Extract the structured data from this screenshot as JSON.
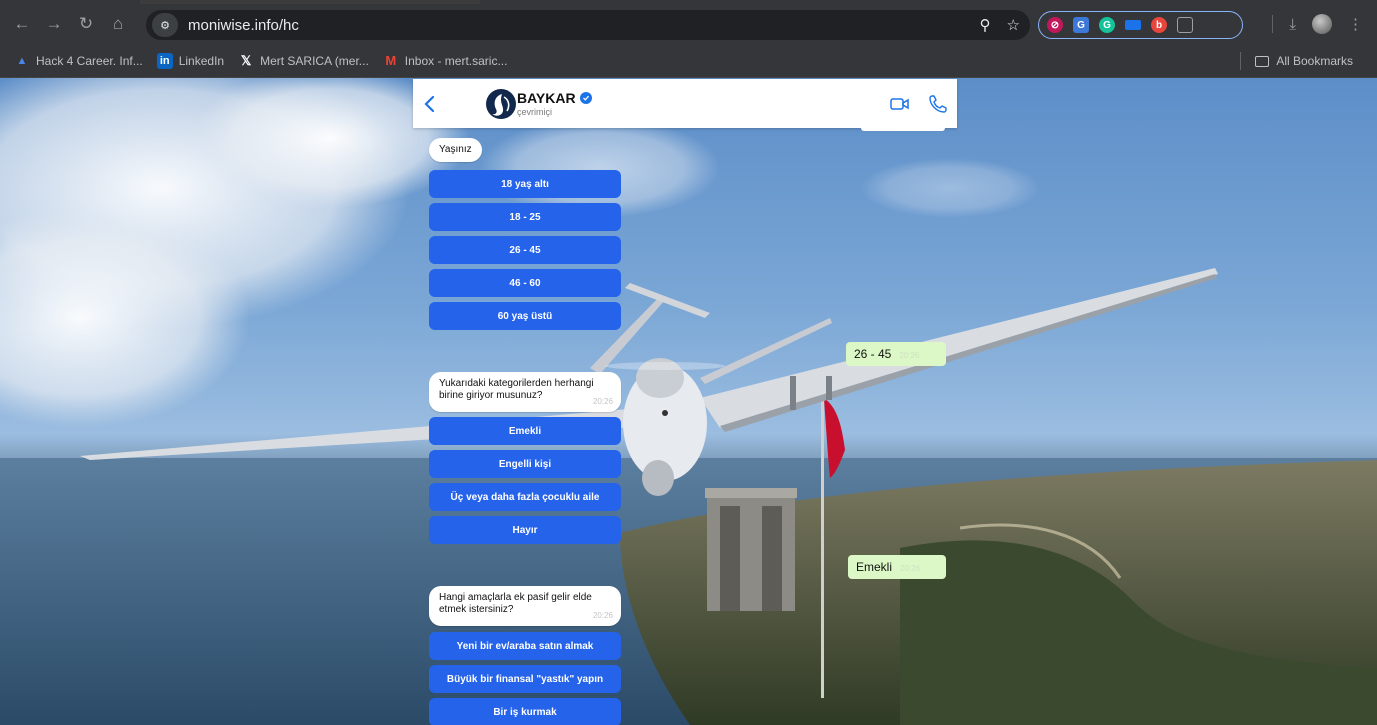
{
  "browser": {
    "url": "moniwise.info/hc",
    "bookmarks": [
      {
        "label": "Hack 4 Career. Inf...",
        "icon": "hack4career-icon"
      },
      {
        "label": "LinkedIn",
        "icon": "linkedin-icon"
      },
      {
        "label": "Mert SARICA (mer...",
        "icon": "x-icon"
      },
      {
        "label": "Inbox - mert.saric...",
        "icon": "gmail-icon"
      }
    ],
    "all_bookmarks": "All Bookmarks"
  },
  "chat": {
    "header": {
      "name": "BAYKAR",
      "status": "çevrimiçi"
    },
    "age_question": {
      "text": "Yaşınız",
      "options": [
        "18 yaş altı",
        "18 - 25",
        "26 - 45",
        "46 - 60",
        "60 yaş üstü"
      ]
    },
    "age_reply": {
      "text": "26 - 45",
      "time": "20:26"
    },
    "category_question": {
      "text": "Yukarıdaki kategorilerden herhangi birine giriyor musunuz?",
      "time": "20:26",
      "options": [
        "Emekli",
        "Engelli kişi",
        "Üç veya daha fazla çocuklu aile",
        "Hayır"
      ]
    },
    "category_reply": {
      "text": "Emekli",
      "time": "20:26"
    },
    "purpose_question": {
      "text": "Hangi amaçlarla ek pasif gelir elde etmek istersiniz?",
      "time": "20:26",
      "options": [
        "Yeni bir ev/araba satın almak",
        "Büyük bir finansal \"yastık\" yapın",
        "Bir iş kurmak"
      ]
    }
  },
  "colors": {
    "button": "#2563eb",
    "reply_bubble": "#dcf8c6",
    "verified": "#1d74e8",
    "chrome_bg": "#35363a"
  }
}
